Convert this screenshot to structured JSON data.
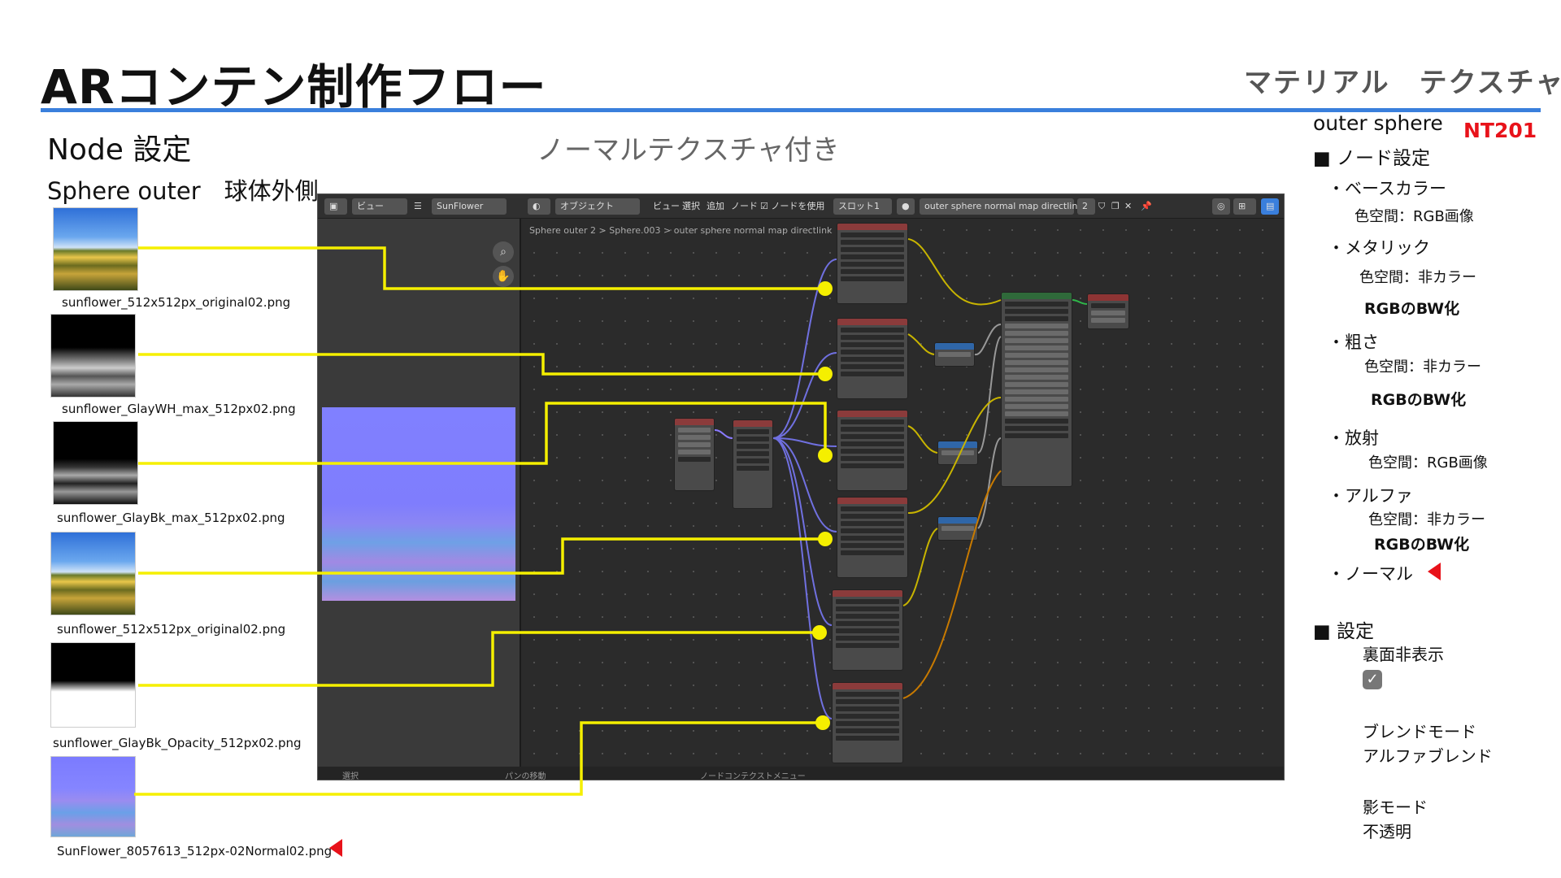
{
  "header": {
    "title": "ARコンテン制作フロー",
    "section": "マテリアル　テクスチャ",
    "rule_color": "#3a7fdc"
  },
  "left": {
    "node_setting": "Node 設定",
    "sphere_outer": "Sphere outer　球体外側",
    "normal_texture_note": "ノーマルテクスチャ付き",
    "textures": [
      {
        "file": "sunflower_512x512px_original02.png",
        "kind": "color"
      },
      {
        "file": "sunflower_GlayWH_max_512px02.png",
        "kind": "grayscale"
      },
      {
        "file": "sunflower_GlayBk_max_512px02.png",
        "kind": "grayscale"
      },
      {
        "file": "sunflower_512x512px_original02.png",
        "kind": "color"
      },
      {
        "file": "sunflower_GlayBk_Opacity_512px02.png",
        "kind": "opacity"
      },
      {
        "file": "SunFlower_8057613_512px-02Normal02.png",
        "kind": "normal"
      }
    ],
    "connector_color": "#f5ef00"
  },
  "blender": {
    "toolbar": {
      "view": "ビュー",
      "image_name": "SunFlower",
      "object": "オブジェクト",
      "menu_view": "ビュー",
      "menu_select": "選択",
      "menu_add": "追加",
      "menu_node": "ノード",
      "use_nodes": "ノードを使用",
      "slot": "スロット1",
      "material_name": "outer sphere normal map directlink",
      "user_count": "2"
    },
    "breadcrumb": [
      "Sphere outer 2",
      "Sphere.003",
      "outer sphere normal map directlink"
    ],
    "status": [
      "選択",
      "パンの移動",
      "ノードコンテクストメニュー"
    ]
  },
  "right": {
    "object_name": "outer sphere",
    "code": "NT201",
    "node_settings_title": "■ ノード設定",
    "items": [
      {
        "label": "・ベースカラー",
        "detail": "色空間：RGB画像",
        "note": ""
      },
      {
        "label": "・メタリック",
        "detail": "色空間：非カラー",
        "note": "RGBのBW化"
      },
      {
        "label": "・粗さ",
        "detail": "色空間：非カラー",
        "note": "RGBのBW化"
      },
      {
        "label": "・放射",
        "detail": "色空間：RGB画像",
        "note": ""
      },
      {
        "label": "・アルファ",
        "detail": "色空間：非カラー",
        "note": "RGBのBW化"
      },
      {
        "label": "・ノーマル",
        "detail": "",
        "note": ""
      }
    ],
    "settings_title": "■ 設定",
    "backface_hide": "裏面非表示",
    "backface_checked": true,
    "blend_mode_label": "ブレンドモード",
    "blend_mode_value": "アルファブレンド",
    "shadow_mode_label": "影モード",
    "shadow_mode_value": "不透明",
    "accent_red": "#e8121a"
  }
}
